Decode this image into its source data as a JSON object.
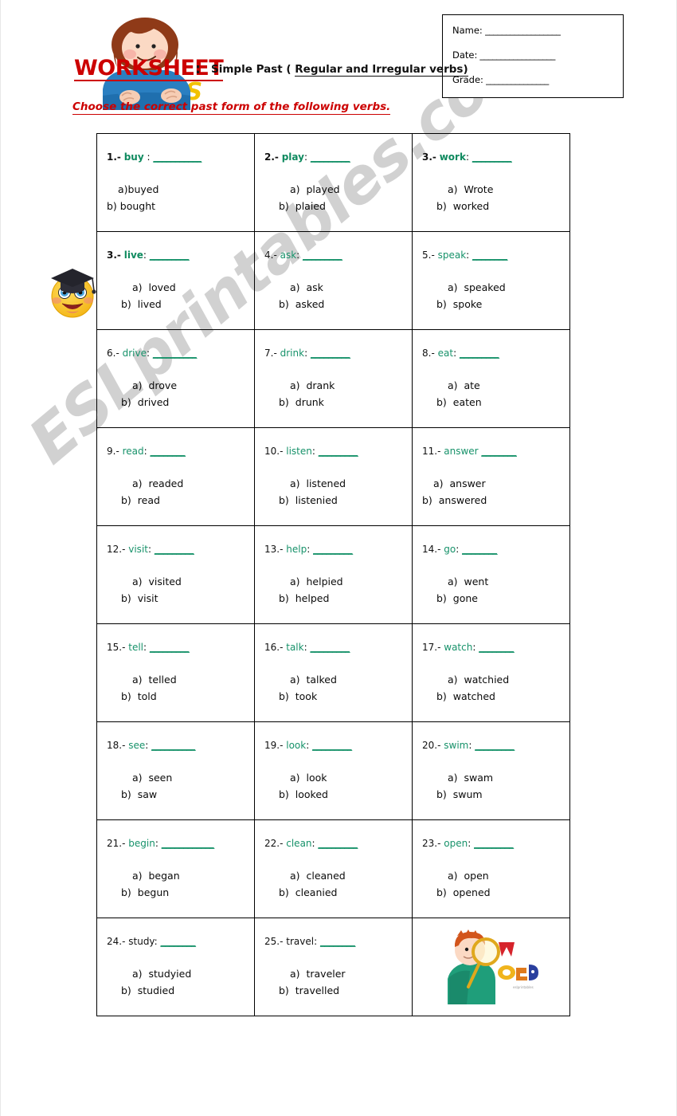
{
  "header": {
    "worksheet_label": "WORKSHEET",
    "colon": ":",
    "verbs_label": "VERBS",
    "subject_prefix": "Simple Past ( ",
    "subject_underlined": "Regular  and Irregular verbs)",
    "instruction": "Choose the correct past form of the following verbs.",
    "accent_red": "#cc0000",
    "accent_yellow": "#f2c200",
    "accent_green": "#17926a"
  },
  "info_box": {
    "rows": [
      {
        "label": "Name:",
        "rule": "__________________"
      },
      {
        "label": "Date:",
        "rule": "__________________"
      },
      {
        "label": "Grade:",
        "rule": "_______________"
      }
    ]
  },
  "watermark": {
    "text": "ESLprintables.com",
    "color": "#c9c9c9"
  },
  "icons": {
    "girl_clipart": "girl-leaning-clipart",
    "graduate_emoji": "graduate-smiley-emoji",
    "boy_clipart": "boy-with-magnifier-clipart"
  },
  "questions": [
    {
      "num": "1.-",
      "verb": "buy",
      "sep": " :",
      "blank": "___________",
      "bold": true,
      "a": "a)buyed",
      "b": "b) bought",
      "indent": false
    },
    {
      "num": "2.-",
      "verb": "play",
      "sep": ":",
      "blank": "_________",
      "bold": true,
      "a": "a)  played",
      "b": "b)  plaied",
      "indent": true
    },
    {
      "num": "3.-",
      "verb": "work",
      "sep": ":",
      "blank": "_________",
      "bold": true,
      "a": "a)  Wrote",
      "b": "b)  worked",
      "indent": true
    },
    {
      "num": "3.-",
      "verb": "live",
      "sep": ":",
      "blank": "_________",
      "bold": true,
      "a": "a)  loved",
      "b": "b)  lived",
      "indent": true
    },
    {
      "num": "4.-",
      "verb": "ask",
      "sep": ":",
      "blank": "_________",
      "bold": false,
      "a": "a)  ask",
      "b": "b)  asked",
      "indent": true
    },
    {
      "num": "5.-",
      "verb": "speak",
      "sep": ":",
      "blank": "________",
      "bold": false,
      "a": "a)  speaked",
      "b": "b)  spoke",
      "indent": true
    },
    {
      "num": "6.-",
      "verb": "drive",
      "sep": ":",
      "blank": "__________",
      "bold": false,
      "a": "a)  drove",
      "b": "b)  drived",
      "indent": true
    },
    {
      "num": "7.-",
      "verb": "drink",
      "sep": ":",
      "blank": "_________",
      "bold": false,
      "a": "a)  drank",
      "b": "b)  drunk",
      "indent": true
    },
    {
      "num": "8.-",
      "verb": "eat",
      "sep": ":",
      "blank": "_________",
      "bold": false,
      "a": "a)  ate",
      "b": "b)  eaten",
      "indent": true
    },
    {
      "num": "9.-",
      "verb": "read",
      "sep": ":",
      "blank": "________",
      "bold": false,
      "a": "a)  readed",
      "b": "b)  read",
      "indent": true
    },
    {
      "num": "10.-",
      "verb": "listen",
      "sep": ":",
      "blank": "_________",
      "bold": false,
      "a": "a)  listened",
      "b": "b)  listenied",
      "indent": true
    },
    {
      "num": "11.-",
      "verb": "answer",
      "sep": "",
      "blank": "________",
      "bold": false,
      "a": "a)  answer",
      "b": "b)  answered",
      "indent": false
    },
    {
      "num": "12.-",
      "verb": "visit",
      "sep": ":",
      "blank": "_________",
      "bold": false,
      "a": "a)  visited",
      "b": "b)  visit",
      "indent": true
    },
    {
      "num": "13.-",
      "verb": "help",
      "sep": ":",
      "blank": "_________",
      "bold": false,
      "a": "a)  helpied",
      "b": "b)  helped",
      "indent": true
    },
    {
      "num": "14.-",
      "verb": "go",
      "sep": ":",
      "blank": "________",
      "bold": false,
      "a": "a)  went",
      "b": "b)  gone",
      "indent": true
    },
    {
      "num": "15.-",
      "verb": "tell",
      "sep": ":",
      "blank": "_________",
      "bold": false,
      "a": "a)  telled",
      "b": "b)  told",
      "indent": true
    },
    {
      "num": "16.-",
      "verb": "talk",
      "sep": ":",
      "blank": "_________",
      "bold": false,
      "a": "a)  talked",
      "b": "b)  took",
      "indent": true
    },
    {
      "num": "17.-",
      "verb": "watch",
      "sep": ":",
      "blank": "________",
      "bold": false,
      "a": "a)  watchied",
      "b": "b)  watched",
      "indent": true
    },
    {
      "num": "18.-",
      "verb": "see",
      "sep": ":",
      "blank": "__________",
      "bold": false,
      "a": "a)  seen",
      "b": "b)  saw",
      "indent": true
    },
    {
      "num": "19.-",
      "verb": "look",
      "sep": ":",
      "blank": "_________",
      "bold": false,
      "a": "a)  look",
      "b": "b)  looked",
      "indent": true
    },
    {
      "num": "20.-",
      "verb": "swim",
      "sep": ":",
      "blank": "_________",
      "bold": false,
      "a": "a)  swam",
      "b": "b)  swum",
      "indent": true
    },
    {
      "num": "21.-",
      "verb": "begin",
      "sep": ":",
      "blank": "____________",
      "bold": false,
      "a": "a)  began",
      "b": "b)  begun",
      "indent": true
    },
    {
      "num": "22.-",
      "verb": "clean",
      "sep": ":",
      "blank": "_________",
      "bold": false,
      "a": "a)  cleaned",
      "b": "b)  cleanied",
      "indent": true
    },
    {
      "num": "23.-",
      "verb": "open",
      "sep": ":",
      "blank": "_________",
      "bold": false,
      "a": "a)  open",
      "b": "b)  opened",
      "indent": true
    },
    {
      "num": "24.-",
      "verb": "study",
      "sep": ":",
      "blank": "________",
      "bold": false,
      "a": "a)  studyied",
      "b": "b)  studied",
      "indent": true,
      "plain_verb": true
    },
    {
      "num": "25.-",
      "verb": "travel",
      "sep": ":",
      "blank": "________",
      "bold": false,
      "a": "a)  traveler",
      "b": "b)  travelled",
      "indent": true,
      "plain_verb": true
    }
  ]
}
